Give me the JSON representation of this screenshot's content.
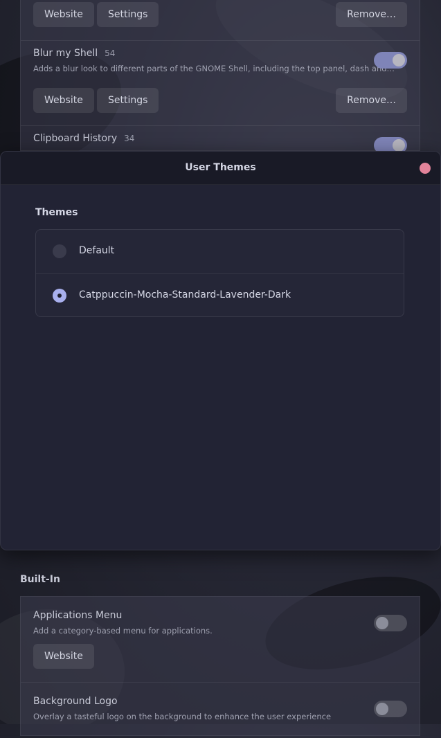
{
  "background_page": {
    "top_row": {
      "website": "Website",
      "settings": "Settings",
      "remove": "Remove…"
    },
    "blur_my_shell": {
      "title": "Blur my Shell",
      "count": "54",
      "description": "Adds a blur look to different parts of the GNOME Shell, including the top panel, dash and…",
      "website": "Website",
      "settings": "Settings",
      "remove": "Remove…",
      "enabled": true
    },
    "clipboard_history": {
      "title": "Clipboard History",
      "count": "34",
      "enabled": true
    },
    "built_in_label": "Built-In",
    "applications_menu": {
      "title": "Applications Menu",
      "description": "Add a category-based menu for applications.",
      "website": "Website",
      "enabled": false
    },
    "background_logo": {
      "title": "Background Logo",
      "description": "Overlay a tasteful logo on the background to enhance the user experience",
      "enabled": false
    }
  },
  "dialog": {
    "title": "User Themes",
    "group_title": "Themes",
    "options": [
      {
        "label": "Default",
        "selected": false
      },
      {
        "label": "Catppuccin-Mocha-Standard-Lavender-Dark",
        "selected": true
      }
    ]
  },
  "colors": {
    "accent": "#a9b0ee",
    "close": "#e2839a",
    "toggle_on": "#7f84b8"
  }
}
